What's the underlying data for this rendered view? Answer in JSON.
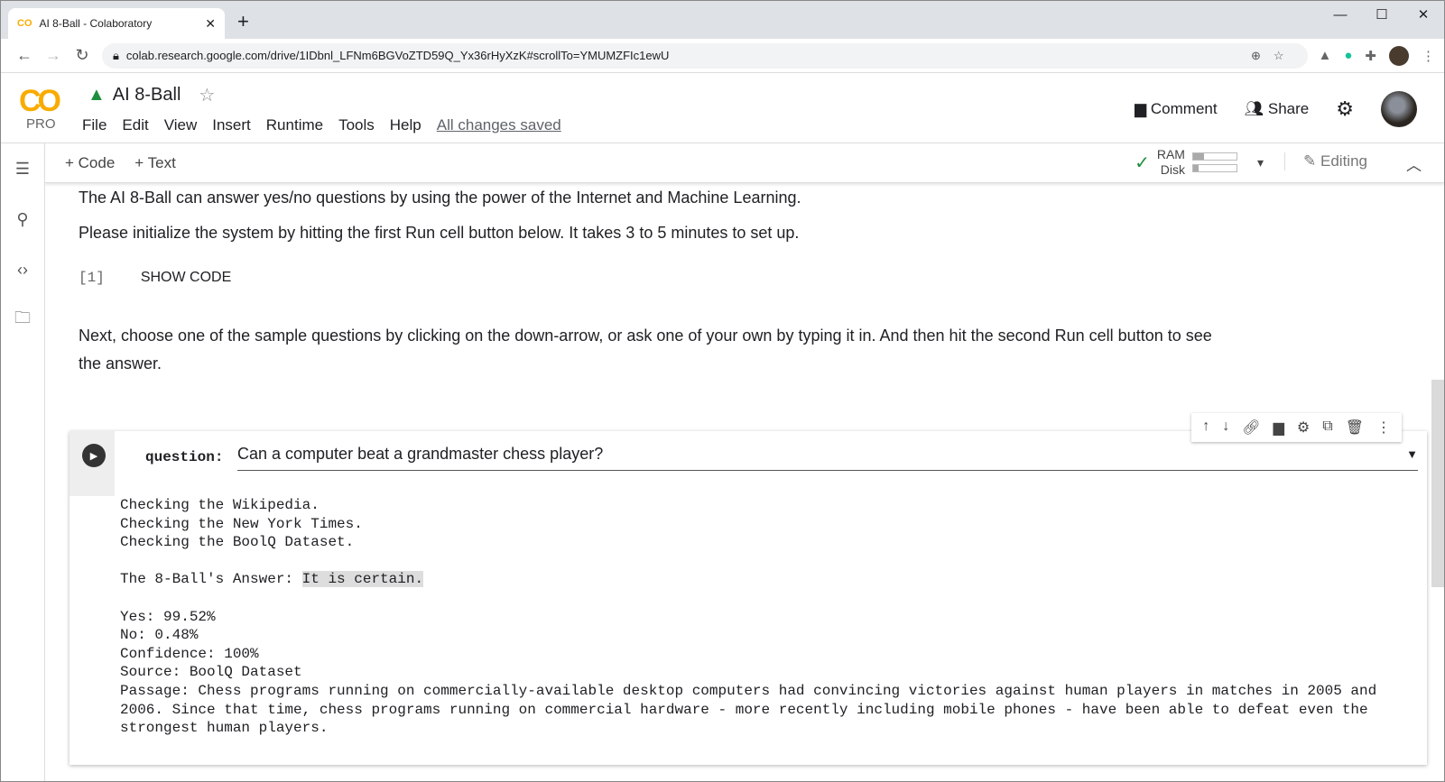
{
  "browser": {
    "tab_title": "AI 8-Ball - Colaboratory",
    "url": "colab.research.google.com/drive/1IDbnl_LFNm6BGVoZTD59Q_Yx36rHyXzK#scrollTo=YMUMZFIc1ewU"
  },
  "app": {
    "logo": "CO",
    "plan": "PRO",
    "title": "AI 8-Ball",
    "menu": [
      "File",
      "Edit",
      "View",
      "Insert",
      "Runtime",
      "Tools",
      "Help"
    ],
    "save_status": "All changes saved",
    "comment": "Comment",
    "share": "Share"
  },
  "toolbar": {
    "code": "+ Code",
    "text": "+ Text",
    "ram": "RAM",
    "disk": "Disk",
    "ram_usage": 0.25,
    "disk_usage": 0.12,
    "mode": "Editing"
  },
  "content": {
    "intro1": "The AI 8-Ball can answer yes/no questions by using the power of the Internet and Machine Learning.",
    "intro2": "Please initialize the system by hitting the first Run cell button below. It takes 3 to 5 minutes to set up.",
    "cell1_number": "[1]",
    "show_code": "SHOW CODE",
    "instructions": "Next, choose one of the sample questions by clicking on the down-arrow, or ask one of your own by typing it in. And then hit the second Run cell button to see the answer."
  },
  "cell": {
    "label": "question:",
    "value": "Can a computer beat a grandmaster chess player?",
    "output_pre": "Checking the Wikipedia.\nChecking the New York Times.\nChecking the BoolQ Dataset.\n\nThe 8-Ball's Answer: ",
    "answer": "It is certain.",
    "output_post": "\n\nYes: 99.52%\nNo: 0.48%\nConfidence: 100%\nSource: BoolQ Dataset\nPassage: Chess programs running on commercially-available desktop computers had convincing victories against human players in matches in 2005 and 2006. Since that time, chess programs running on commercial hardware - more recently including mobile phones - have been able to defeat even the strongest human players."
  }
}
